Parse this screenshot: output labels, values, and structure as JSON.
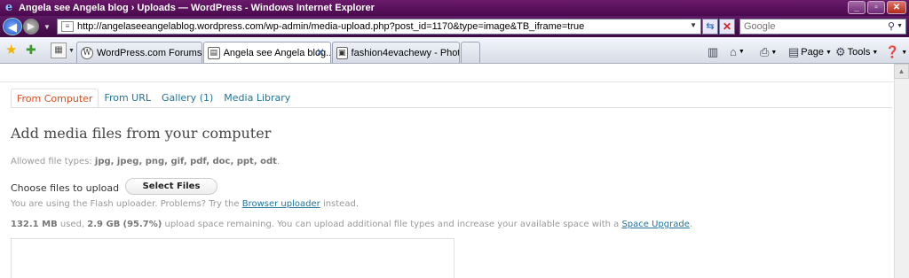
{
  "window": {
    "title": "Angela see Angela blog › Uploads — WordPress - Windows Internet Explorer",
    "minimize": "_",
    "maximize": "▫",
    "close": "✕"
  },
  "address": {
    "url": "http://angelaseeangelablog.wordpress.com/wp-admin/media-upload.php?post_id=1170&type=image&TB_iframe=true"
  },
  "search": {
    "placeholder": "Google"
  },
  "tabs": [
    {
      "label": "WordPress.com Forums"
    },
    {
      "label": "Angela see Angela blog..."
    },
    {
      "label": "fashion4evachewy - Photo..."
    }
  ],
  "commands": {
    "page": "Page",
    "tools": "Tools"
  },
  "media": {
    "tabs": [
      "From Computer",
      "From URL",
      "Gallery (1)",
      "Media Library"
    ],
    "heading": "Add media files from your computer",
    "allowed_prefix": "Allowed file types:",
    "allowed_types": "jpg, jpeg, png, gif, pdf, doc, ppt, odt",
    "allowed_suffix": ".",
    "choose_label": "Choose files to upload",
    "select_button": "Select Files",
    "flash_text": "You are using the Flash uploader. Problems? Try the",
    "flash_link": "Browser uploader",
    "flash_suffix": "instead.",
    "used": "132.1 MB",
    "used_label": "used,",
    "remaining": "2.9 GB",
    "percent": "(95.7%)",
    "space_text": "upload space remaining. You can upload additional file types and increase your available space with a",
    "space_link": "Space Upgrade",
    "space_suffix": "."
  },
  "colors": {
    "link": "#21759b",
    "current_tab": "#d54e21",
    "titlebar": "#5c1a62"
  }
}
